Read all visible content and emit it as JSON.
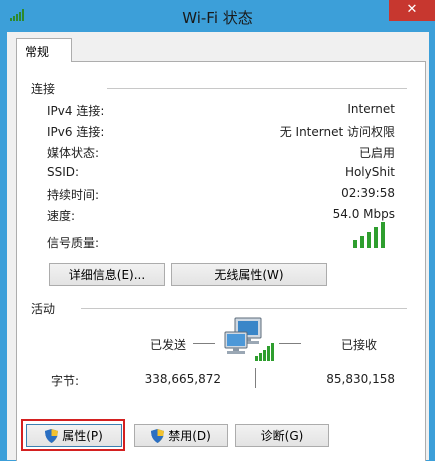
{
  "window": {
    "title": "Wi-Fi 状态",
    "close_glyph": "✕"
  },
  "tabs": [
    {
      "label": "常规"
    }
  ],
  "connection": {
    "group_label": "连接",
    "rows": [
      {
        "label": "IPv4 连接:",
        "value": "Internet"
      },
      {
        "label": "IPv6 连接:",
        "value": "无 Internet 访问权限"
      },
      {
        "label": "媒体状态:",
        "value": "已启用"
      },
      {
        "label": "SSID:",
        "value": "HolyShit"
      },
      {
        "label": "持续时间:",
        "value": "02:39:58"
      },
      {
        "label": "速度:",
        "value": "54.0 Mbps"
      }
    ],
    "signal_label": "信号质量:",
    "signal_bars_filled": 5,
    "signal_bars_total": 5,
    "details_button": "详细信息(E)...",
    "wireless_props_button": "无线属性(W)"
  },
  "activity": {
    "group_label": "活动",
    "sent_label": "已发送",
    "received_label": "已接收",
    "bytes_label": "字节:",
    "bytes_sent": "338,665,872",
    "bytes_received": "85,830,158"
  },
  "buttons": {
    "properties": "属性(P)",
    "disable": "禁用(D)",
    "diagnose": "诊断(G)"
  },
  "colors": {
    "titlebar": "#3c9fd9",
    "close": "#c7372f",
    "signal": "#2e9e2e",
    "highlight": "#d42020"
  }
}
